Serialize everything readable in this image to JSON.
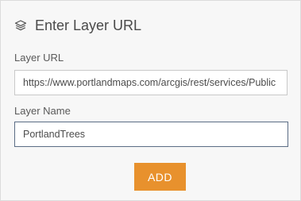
{
  "panel": {
    "title": "Enter Layer URL",
    "title_icon": "layers-icon"
  },
  "form": {
    "url_label": "Layer URL",
    "url_value": "https://www.portlandmaps.com/arcgis/rest/services/Public",
    "name_label": "Layer Name",
    "name_value": "PortlandTrees",
    "add_label": "ADD"
  },
  "colors": {
    "accent": "#e8912d",
    "panel_background": "#f7f7f7",
    "focused_border": "#5b6d85"
  }
}
